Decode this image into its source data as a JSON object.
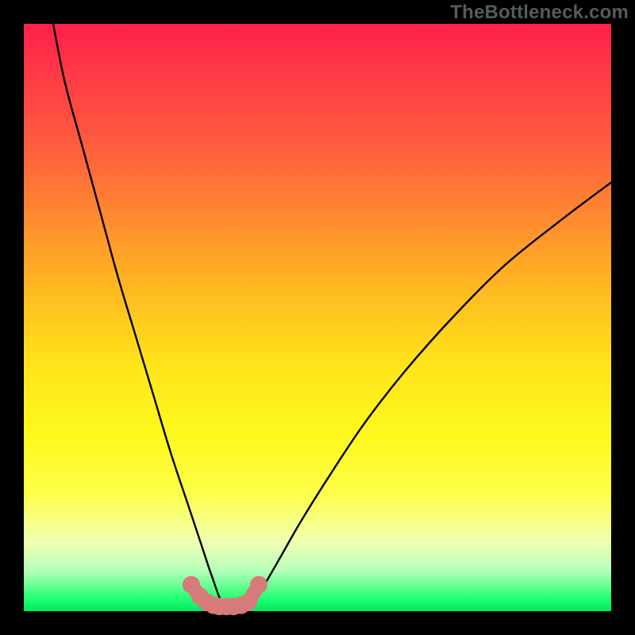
{
  "watermark": "TheBottleneck.com",
  "colors": {
    "background": "#000000",
    "curve": "#000000",
    "marker_fill": "#d77a7a",
    "gradient_stops": [
      "#ff1f4b",
      "#ff3846",
      "#ff5a3e",
      "#ff8a2f",
      "#ffb821",
      "#ffe41a",
      "#fff81e",
      "#fdff49",
      "#f2ffb0",
      "#b6ffbb",
      "#5eff8c",
      "#1cff70",
      "#00e763"
    ]
  },
  "chart_data": {
    "type": "line",
    "title": "",
    "xlabel": "",
    "ylabel": "",
    "xlim": [
      0,
      100
    ],
    "ylim": [
      0,
      100
    ],
    "legend": false,
    "grid": false,
    "curve_note": "V-shaped bottleneck curve with minimum near x≈34 reaching y≈0",
    "series": [
      {
        "name": "bottleneck-curve",
        "marker_color": "#d77a7a",
        "x": [
          5,
          7,
          10,
          13,
          16,
          19,
          22,
          25,
          28,
          30,
          32,
          34,
          36,
          38,
          40,
          43,
          47,
          52,
          58,
          65,
          73,
          82,
          92,
          100
        ],
        "y": [
          100,
          90,
          79,
          68,
          57,
          47,
          37,
          27,
          18,
          12,
          6,
          1,
          1,
          1,
          3,
          8,
          15,
          23,
          32,
          41,
          50,
          59,
          67,
          73
        ],
        "markers_x": [
          28.5,
          30.0,
          31.2,
          32.3,
          33.3,
          34.5,
          35.7,
          37.0,
          38.2,
          40.0
        ],
        "markers_y": [
          4.5,
          2.5,
          1.5,
          1.0,
          0.8,
          0.8,
          0.8,
          1.0,
          1.5,
          4.5
        ]
      }
    ]
  }
}
